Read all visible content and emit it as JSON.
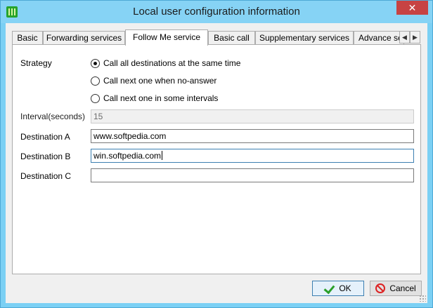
{
  "window": {
    "title": "Local user configuration information",
    "close_glyph": "✕",
    "app_icon": "green-bars-icon"
  },
  "tabs": [
    {
      "label": "Basic",
      "active": false
    },
    {
      "label": "Forwarding services",
      "active": false
    },
    {
      "label": "Follow Me service",
      "active": true
    },
    {
      "label": "Basic call",
      "active": false
    },
    {
      "label": "Supplementary services",
      "active": false
    },
    {
      "label": "Advance ser",
      "active": false
    }
  ],
  "tab_scroll": {
    "left": "◀",
    "right": "▶"
  },
  "form": {
    "strategy_label": "Strategy",
    "strategy_options": [
      {
        "label": "Call all destinations at the same time",
        "checked": true
      },
      {
        "label": "Call next one when no-answer",
        "checked": false
      },
      {
        "label": "Call next one in some intervals",
        "checked": false
      }
    ],
    "interval_label": "Interval(seconds)",
    "interval_value": "15",
    "destination_a_label": "Destination A",
    "destination_a_value": "www.softpedia.com",
    "destination_b_label": "Destination B",
    "destination_b_value": "win.softpedia.com",
    "destination_c_label": "Destination C",
    "destination_c_value": ""
  },
  "buttons": {
    "ok_label": "OK",
    "cancel_label": "Cancel"
  },
  "colors": {
    "titlebar": "#86d3f5",
    "close": "#c74343",
    "ok_check": "#2aa02a",
    "cancel_icon": "#dd2222"
  }
}
